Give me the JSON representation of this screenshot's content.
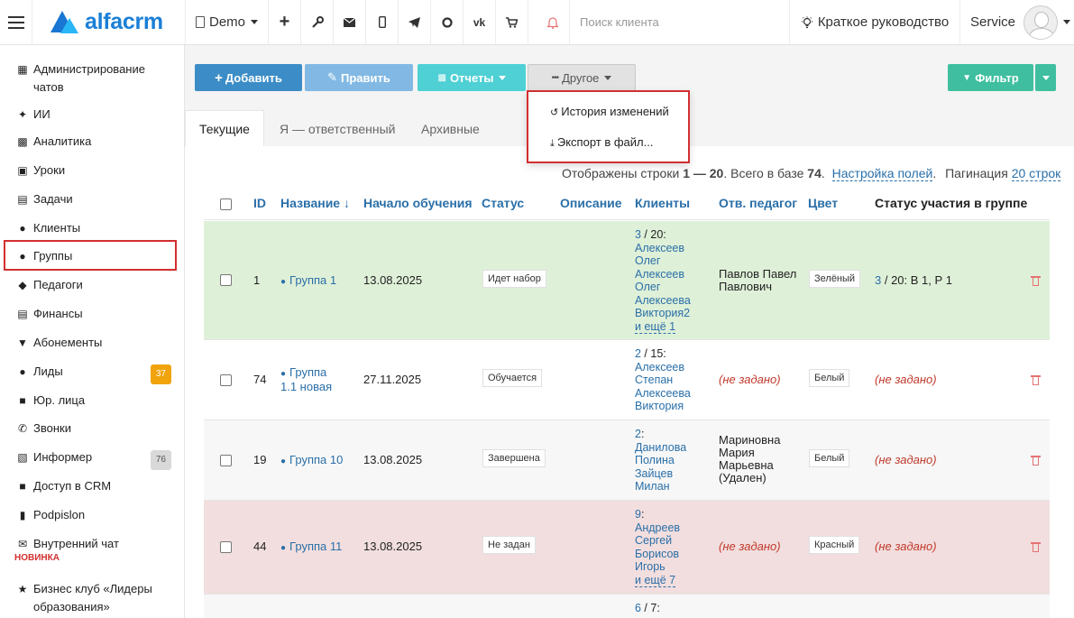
{
  "topbar": {
    "logo": "alfacrm",
    "branch": "Demo",
    "search_placeholder": "Поиск клиента",
    "guide": "Краткое руководство",
    "user": "Service",
    "icons": [
      "plus-icon",
      "wrench-icon",
      "mail-icon",
      "mobile-icon",
      "telegram-icon",
      "chat-icon",
      "vk-icon",
      "cart-icon",
      "bell-icon"
    ]
  },
  "sidebar": {
    "items": [
      {
        "label": "Администрирование чатов",
        "icon": "chat-admin-icon"
      },
      {
        "label": "ИИ",
        "icon": "sparkle-icon"
      },
      {
        "label": "Аналитика",
        "icon": "map-icon"
      },
      {
        "label": "Уроки",
        "icon": "calendar-icon"
      },
      {
        "label": "Задачи",
        "icon": "clipboard-icon"
      },
      {
        "label": "Клиенты",
        "icon": "user-icon"
      },
      {
        "label": "Группы",
        "icon": "users-icon"
      },
      {
        "label": "Педагоги",
        "icon": "graduation-cap-icon"
      },
      {
        "label": "Финансы",
        "icon": "money-icon"
      },
      {
        "label": "Абонементы",
        "icon": "tag-icon"
      },
      {
        "label": "Лиды",
        "icon": "user-plus-icon",
        "badge": "37",
        "badge_color": "#f0a30a"
      },
      {
        "label": "Юр. лица",
        "icon": "briefcase-icon"
      },
      {
        "label": "Звонки",
        "icon": "phone-icon"
      },
      {
        "label": "Информер",
        "icon": "inbox-icon",
        "badge": "76",
        "badge_color": "#d9d9d9"
      },
      {
        "label": "Доступ в CRM",
        "icon": "lock-icon"
      },
      {
        "label": "Podpislon",
        "icon": "file-icon"
      },
      {
        "label": "Внутренний чат",
        "icon": "envelope-icon"
      },
      {
        "label": "Бизнес клуб «Лидеры образования»",
        "icon": "star-icon"
      }
    ],
    "new_tag": "НОВИНКА"
  },
  "toolbar": {
    "add": "Добавить",
    "edit": "Править",
    "reports": "Отчеты",
    "other": "Другое",
    "filter": "Фильтр"
  },
  "dropdown": {
    "history": "История изменений",
    "export": "Экспорт в файл..."
  },
  "tabs": [
    "Текущие",
    "Я — ответственный",
    "Архивные"
  ],
  "info": {
    "prefix": "Отображены строки ",
    "range": "1 — 20",
    "middle": ". Всего в базе ",
    "total": "74",
    "dot": ".",
    "fields_link": "Настройка полей",
    "pagination_label": "Пагинация",
    "pagination_link": "20 строк"
  },
  "columns": {
    "id": "ID",
    "name": "Название ↓",
    "start": "Начало обучения",
    "status": "Статус",
    "desc": "Описание",
    "clients": "Клиенты",
    "teacher": "Отв. педагог",
    "color": "Цвет",
    "participation": "Статус участия в группе"
  },
  "rows": [
    {
      "id": "1",
      "name": "Группа 1",
      "start": "13.08.2025",
      "status": "Идет набор",
      "clients_count": "3",
      "clients_total": " / 20:",
      "clients_list": "Алексеев Олег Алексеев Олег Алексеева Виктория2",
      "clients_more": "и ещё 1",
      "teacher": "Павлов Павел Павлович",
      "color": "Зелёный",
      "participation_count": "3",
      "participation_text": " / 20:  В 1, Р 1",
      "bg": "#dff0d8"
    },
    {
      "id": "74",
      "name": "Группа 1.1 новая",
      "start": "27.11.2025",
      "status": "Обучается",
      "clients_count": "2",
      "clients_total": " / 15:",
      "clients_list": "Алексеев Степан Алексеева Виктория",
      "clients_more": "",
      "teacher": "(не задано)",
      "color": "Белый",
      "participation_text": "(не задано)",
      "bg": "#ffffff"
    },
    {
      "id": "19",
      "name": "Группа 10",
      "start": "13.08.2025",
      "status": "Завершена",
      "clients_count": "2",
      "clients_total": ":",
      "clients_list": "Данилова Полина Зайцев Милан",
      "clients_more": "",
      "teacher": "Мариновна Мария Марьевна (Удален)",
      "color": "Белый",
      "participation_text": "(не задано)",
      "bg": "#f7f7f7"
    },
    {
      "id": "44",
      "name": "Группа 11",
      "start": "13.08.2025",
      "status": "Не задан",
      "clients_count": "9",
      "clients_total": ":",
      "clients_list": "Андреев Сергей Борисов Игорь",
      "clients_more": "и ещё 7",
      "teacher": "(не задано)",
      "color": "Красный",
      "participation_text": "(не задано)",
      "bg": "#f2dede"
    },
    {
      "clients_count": "6",
      "clients_total": " / 7:"
    }
  ]
}
